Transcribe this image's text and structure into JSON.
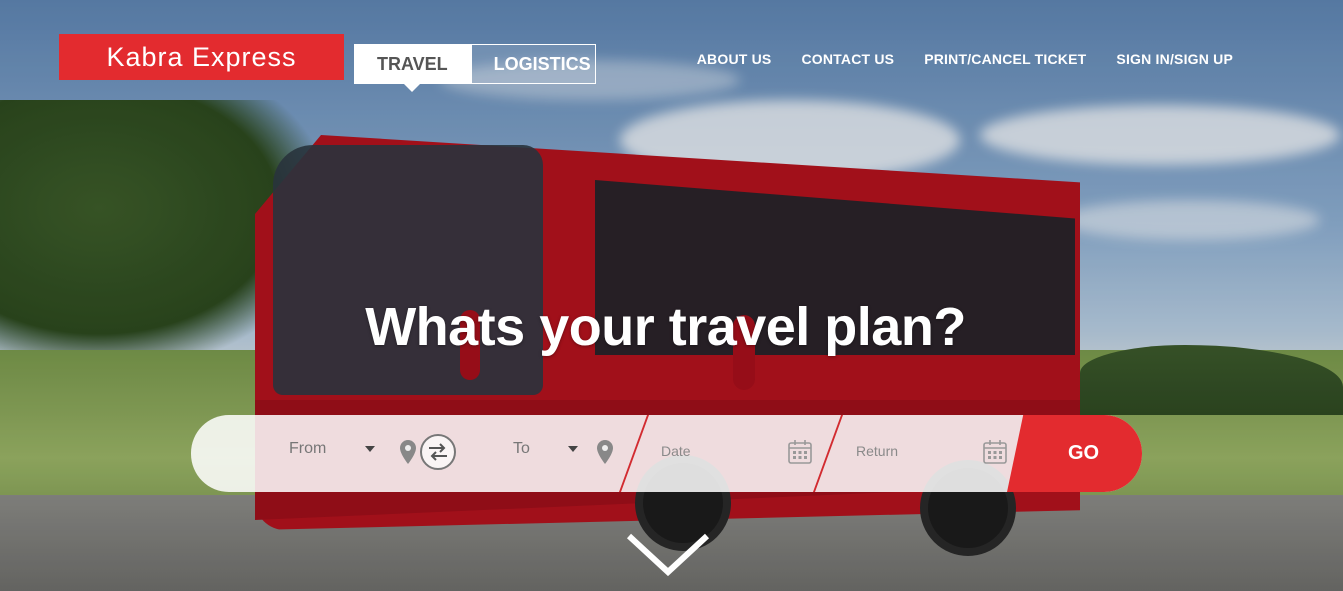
{
  "brand": {
    "logo_text": "Kabra Express",
    "accent": "#e32b2f"
  },
  "tabs": [
    {
      "label": "TRAVEL",
      "active": true
    },
    {
      "label": "LOGISTICS",
      "active": false
    }
  ],
  "nav": {
    "about": "ABOUT US",
    "contact": "CONTACT US",
    "print": "PRINT/CANCEL TICKET",
    "signin": "SIGN IN/SIGN UP"
  },
  "hero": {
    "headline": "Whats your travel plan?"
  },
  "search": {
    "from_placeholder": "From",
    "to_placeholder": "To",
    "date_placeholder": "Date",
    "return_placeholder": "Return",
    "go_label": "GO"
  },
  "icons": {
    "location": "map-pin-icon",
    "swap": "swap-icon",
    "calendar": "calendar-icon",
    "scroll": "chevron-down-icon"
  }
}
